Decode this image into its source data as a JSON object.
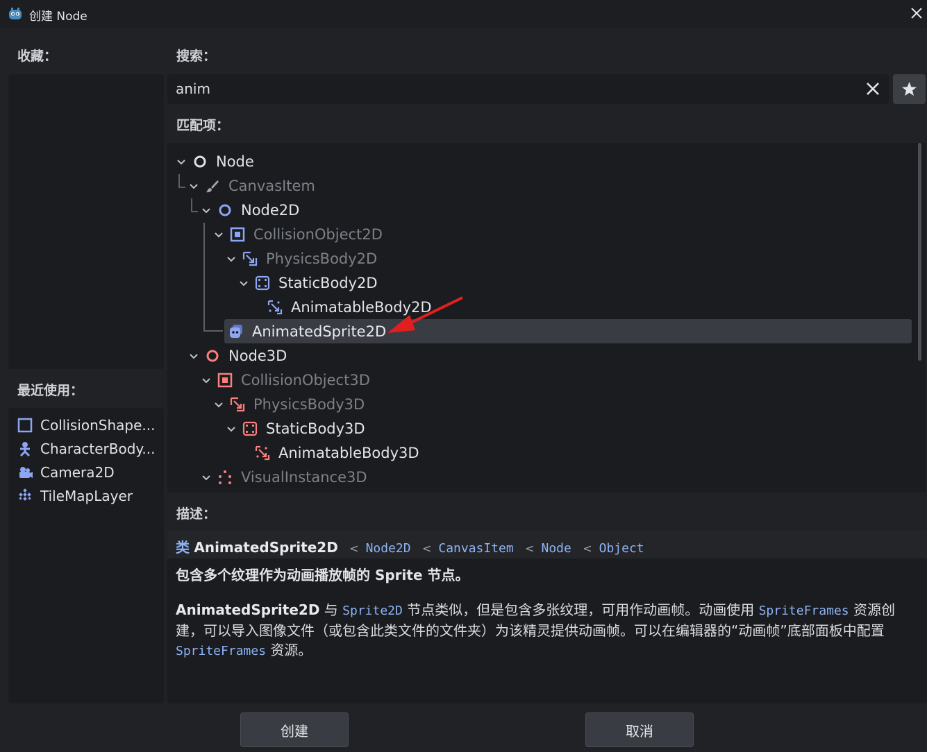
{
  "window": {
    "title": "创建 Node"
  },
  "labels": {
    "favorites": "收藏：",
    "recent": "最近使用：",
    "search": "搜索：",
    "matches": "匹配项：",
    "description": "描述："
  },
  "search": {
    "value": "anim"
  },
  "recent": [
    {
      "label": "CollisionShape...",
      "icon": "collision-shape-icon"
    },
    {
      "label": "CharacterBody...",
      "icon": "character-body-icon"
    },
    {
      "label": "Camera2D",
      "icon": "camera2d-icon"
    },
    {
      "label": "TileMapLayer",
      "icon": "tilemap-layer-icon"
    }
  ],
  "tree": [
    {
      "label": "Node",
      "icon": "node-icon",
      "expanded": true
    },
    {
      "label": "CanvasItem",
      "icon": "canvas-item-icon",
      "expanded": true,
      "dim": true
    },
    {
      "label": "Node2D",
      "icon": "node2d-icon",
      "expanded": true
    },
    {
      "label": "CollisionObject2D",
      "icon": "collision-object2d-icon",
      "expanded": true,
      "dim": true
    },
    {
      "label": "PhysicsBody2D",
      "icon": "physics-body2d-icon",
      "expanded": true,
      "dim": true
    },
    {
      "label": "StaticBody2D",
      "icon": "static-body2d-icon",
      "expanded": true
    },
    {
      "label": "AnimatableBody2D",
      "icon": "animatable-body2d-icon"
    },
    {
      "label": "AnimatedSprite2D",
      "icon": "animated-sprite2d-icon",
      "selected": true
    },
    {
      "label": "Node3D",
      "icon": "node3d-icon",
      "expanded": true
    },
    {
      "label": "CollisionObject3D",
      "icon": "collision-object3d-icon",
      "expanded": true,
      "dim": true
    },
    {
      "label": "PhysicsBody3D",
      "icon": "physics-body3d-icon",
      "expanded": true,
      "dim": true
    },
    {
      "label": "StaticBody3D",
      "icon": "static-body3d-icon",
      "expanded": true
    },
    {
      "label": "AnimatableBody3D",
      "icon": "animatable-body3d-icon"
    },
    {
      "label": "VisualInstance3D",
      "icon": "visual-instance3d-icon",
      "expanded": true,
      "dim": true
    }
  ],
  "description": {
    "class_prefix": "类",
    "class_name": "AnimatedSprite2D",
    "inherits": [
      "Node2D",
      "CanvasItem",
      "Node",
      "Object"
    ],
    "brief": "包含多个纹理作为动画播放帧的 Sprite 节点。",
    "body_name": "AnimatedSprite2D",
    "body_1": " 与 ",
    "body_link_1": "Sprite2D",
    "body_2": " 节点类似，但是包含多张纹理，可用作动画帧。动画使用 ",
    "body_link_2": "SpriteFrames",
    "body_3": " 资源创建，可以导入图像文件（或包含此类文件的文件夹）为该精灵提供动画帧。可以在编辑器的“动画帧”底部面板中配置 ",
    "body_link_3": "SpriteFrames",
    "body_4": " 资源。"
  },
  "buttons": {
    "create": "创建",
    "cancel": "取消"
  },
  "colors": {
    "accent_2d": "#8da5f3",
    "accent_3d": "#fc7f7f",
    "annotation": "#e02020"
  }
}
